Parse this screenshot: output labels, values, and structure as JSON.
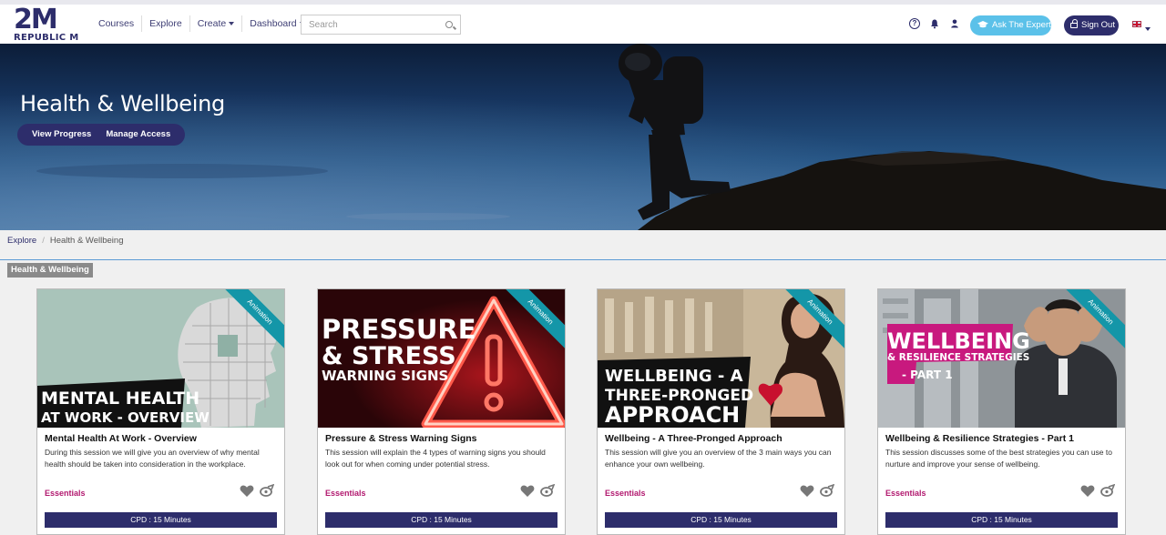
{
  "header": {
    "logo_mark": "2M",
    "logo_text": "REPUBLIC M",
    "nav": [
      {
        "label": "Courses",
        "dropdown": false
      },
      {
        "label": "Explore",
        "dropdown": false
      },
      {
        "label": "Create",
        "dropdown": true
      },
      {
        "label": "Dashboard",
        "dropdown": true
      }
    ],
    "search_placeholder": "Search",
    "help_glyph": "?",
    "ask_label": "Ask The Expert",
    "signout_label": "Sign Out",
    "colors": {
      "brand": "#2d2d6b",
      "ask": "#5bc1e9"
    }
  },
  "hero": {
    "title": "Health & Wellbeing",
    "actions": [
      "View Progress",
      "Manage Access"
    ]
  },
  "breadcrumb": {
    "items": [
      "Explore",
      "Health & Wellbeing"
    ]
  },
  "section_tag": "Health & Wellbeing",
  "cards": [
    {
      "ribbon": "Animation",
      "image_lines": [
        "MENTAL HEALTH",
        "AT WORK - OVERVIEW"
      ],
      "title": "Mental Health At Work - Overview",
      "desc": "During this session we will give you an overview of why mental health should be taken into consideration in the workplace.",
      "badge": "Essentials",
      "cpd": "CPD : 15 Minutes"
    },
    {
      "ribbon": "Animation",
      "image_lines": [
        "PRESSURE",
        "& STRESS",
        "WARNING SIGNS"
      ],
      "title": "Pressure & Stress Warning Signs",
      "desc": "This session will explain the 4 types of warning signs you should look out for when coming under potential stress.",
      "badge": "Essentials",
      "cpd": "CPD : 15 Minutes"
    },
    {
      "ribbon": "Animation",
      "image_lines": [
        "WELLBEING - A",
        "THREE-PRONGED",
        "APPROACH"
      ],
      "title": "Wellbeing - A Three-Pronged Approach",
      "desc": "This session will give you an overview of the 3 main ways you can enhance your own wellbeing.",
      "badge": "Essentials",
      "cpd": "CPD : 15 Minutes"
    },
    {
      "ribbon": "Animation",
      "image_lines": [
        "WELLBEING",
        "& RESILIENCE STRATEGIES",
        "- PART 1"
      ],
      "title": "Wellbeing & Resilience Strategies - Part 1",
      "desc": "This session discusses some of the best strategies you can use to nurture and improve your sense of wellbeing.",
      "badge": "Essentials",
      "cpd": "CPD : 15 Minutes"
    }
  ]
}
